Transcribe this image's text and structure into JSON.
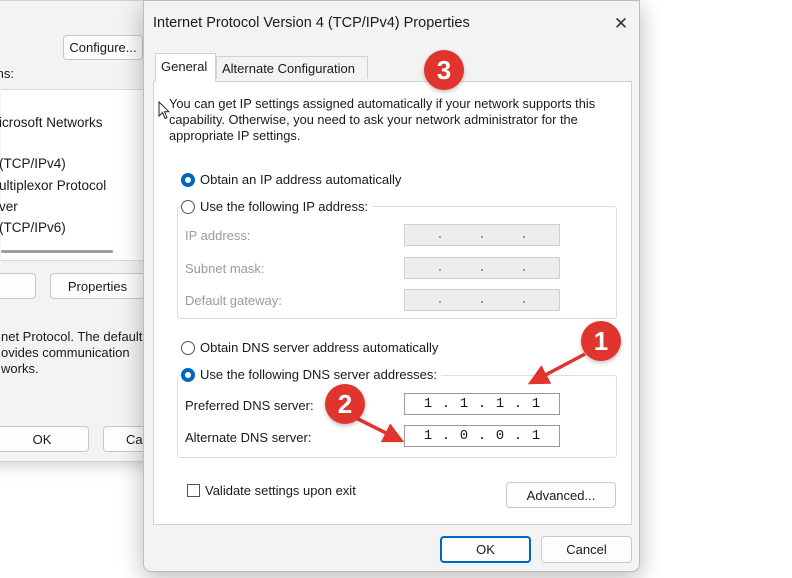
{
  "background_window": {
    "configure_button": "Configure...",
    "items_label_fragment": "ms:",
    "list_items": [
      "icrosoft Networks",
      "(TCP/IPv4)",
      "ultiplexor Protocol",
      "ver",
      "(TCP/IPv6)"
    ],
    "properties_button": "Properties",
    "description_lines": [
      "net Protocol. The default",
      "ovides communication",
      "works."
    ],
    "ok_button": "OK",
    "cancel_button_fragment": "Ca"
  },
  "dialog": {
    "title": "Internet Protocol Version 4 (TCP/IPv4) Properties",
    "close_glyph": "✕",
    "tabs": [
      {
        "label": "General",
        "active": true
      },
      {
        "label": "Alternate Configuration",
        "active": false
      }
    ],
    "intro_text": "You can get IP settings assigned automatically if your network supports this capability. Otherwise, you need to ask your network administrator for the appropriate IP settings.",
    "ip_mode": {
      "auto_label": "Obtain an IP address automatically",
      "manual_label": "Use the following IP address:",
      "selected": "auto"
    },
    "ip_fields": [
      {
        "label": "IP address:",
        "dots": ".  .  ."
      },
      {
        "label": "Subnet mask:",
        "dots": ".  .  ."
      },
      {
        "label": "Default gateway:",
        "dots": ".  .  ."
      }
    ],
    "dns_mode": {
      "auto_label": "Obtain DNS server address automatically",
      "manual_label": "Use the following DNS server addresses:",
      "selected": "manual"
    },
    "dns_fields": [
      {
        "label": "Preferred DNS server:",
        "octets": [
          "1",
          ".",
          "1",
          ".",
          "1",
          ".",
          "1"
        ]
      },
      {
        "label": "Alternate DNS server:",
        "octets": [
          "1",
          ".",
          "0",
          ".",
          "0",
          ".",
          "1"
        ]
      }
    ],
    "validate_label": "Validate settings upon exit",
    "validate_checked": false,
    "advanced_button": "Advanced...",
    "ok_button": "OK",
    "cancel_button": "Cancel"
  },
  "annotations": {
    "marker_1": "1",
    "marker_2": "2",
    "marker_3": "3",
    "marker_color": "#e0342e"
  },
  "colors": {
    "accent": "#0067c0",
    "dialog_bg": "#f3f3f3",
    "panel_bg": "#ffffff"
  }
}
